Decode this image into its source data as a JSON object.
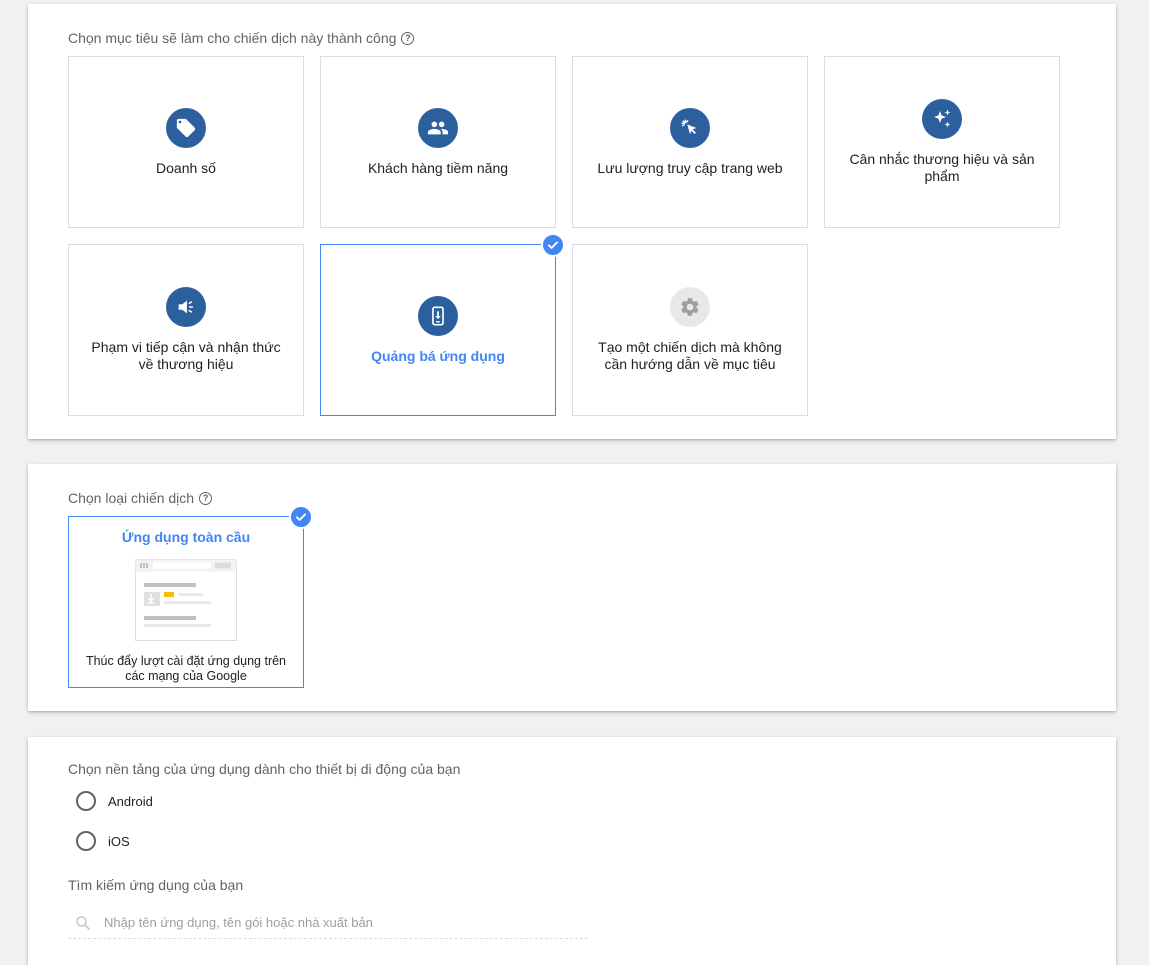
{
  "goals_section": {
    "title": "Chọn mục tiêu sẽ làm cho chiến dịch này thành công",
    "goals": [
      {
        "label": "Doanh số",
        "icon": "tag-icon"
      },
      {
        "label": "Khách hàng tiềm năng",
        "icon": "people-icon"
      },
      {
        "label": "Lưu lượng truy cập trang web",
        "icon": "cursor-click-icon"
      },
      {
        "label": "Cân nhắc thương hiệu và sản phẩm",
        "icon": "sparkle-icon"
      },
      {
        "label": "Phạm vi tiếp cận và nhận thức về thương hiệu",
        "icon": "megaphone-icon"
      },
      {
        "label": "Quảng bá ứng dụng",
        "icon": "phone-download-icon",
        "selected": true
      },
      {
        "label": "Tạo một chiến dịch mà không cần hướng dẫn về mục tiêu",
        "icon": "gear-icon"
      }
    ]
  },
  "campaign_type_section": {
    "title": "Chọn loại chiến dịch",
    "type": {
      "title": "Ứng dụng toàn cầu",
      "description": "Thúc đẩy lượt cài đặt ứng dụng trên các mạng của Google",
      "selected": true
    }
  },
  "platform_section": {
    "title": "Chọn nền tảng của ứng dụng dành cho thiết bị di động của bạn",
    "options": [
      {
        "label": "Android"
      },
      {
        "label": "iOS"
      }
    ],
    "search_label": "Tìm kiếm ứng dụng của bạn",
    "search_placeholder": "Nhập tên ứng dụng, tên gói hoặc nhà xuất bản"
  },
  "colors": {
    "accent": "#4285f4",
    "icon_bg": "#2b5f9e",
    "border": "#dadce0"
  }
}
